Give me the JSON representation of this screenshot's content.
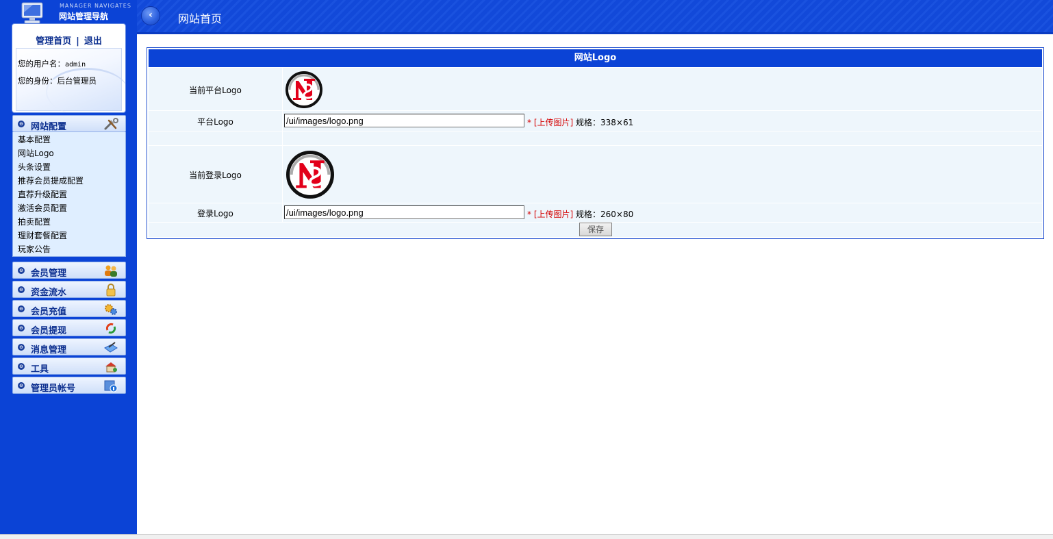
{
  "brand": {
    "subtitle": "MANAGER NAVIGATES",
    "title": "网站管理导航"
  },
  "user_panel": {
    "home_link": "管理首页",
    "separator": "|",
    "logout_link": "退出",
    "username_label": "您的用户名：",
    "username": "admin",
    "role_label": "您的身份：",
    "role": "后台管理员"
  },
  "sidebar": {
    "active_group": {
      "label": "网站配置",
      "icon": "tools-icon"
    },
    "sub_items": [
      {
        "label": "基本配置"
      },
      {
        "label": "网站Logo"
      },
      {
        "label": "头条设置"
      },
      {
        "label": "推荐会员提成配置"
      },
      {
        "label": "直荐升级配置"
      },
      {
        "label": "激活会员配置"
      },
      {
        "label": "拍卖配置"
      },
      {
        "label": "理财套餐配置"
      },
      {
        "label": "玩家公告"
      }
    ],
    "groups": [
      {
        "label": "会员管理",
        "icon": "users-icon"
      },
      {
        "label": "资金流水",
        "icon": "lock-icon"
      },
      {
        "label": "会员充值",
        "icon": "gears-icon"
      },
      {
        "label": "会员提现",
        "icon": "refresh-icon"
      },
      {
        "label": "消息管理",
        "icon": "message-icon"
      },
      {
        "label": "工具",
        "icon": "toolbox-icon"
      },
      {
        "label": "管理员帐号",
        "icon": "admin-info-icon"
      }
    ]
  },
  "header": {
    "back_icon": "back-arrow-icon",
    "back_label": "‹",
    "title": "网站首页"
  },
  "panel": {
    "title": "网站Logo",
    "rows": {
      "current_platform_logo": {
        "label": "当前平台Logo"
      },
      "platform_logo": {
        "label": "平台Logo",
        "value": "/ui/images/logo.png",
        "star": "*",
        "upload_link": "[上传图片]",
        "spec": " 规格：338×61"
      },
      "current_login_logo": {
        "label": "当前登录Logo"
      },
      "login_logo": {
        "label": "登录Logo",
        "value": "/ui/images/logo.png",
        "star": "*",
        "upload_link": "[上传图片]",
        "spec": " 规格：260×80"
      }
    },
    "save_button": "保存"
  },
  "colors": {
    "sidebar_bg": "#0b43d6",
    "header_bg": "#1249d9",
    "panel_head_bg": "#0b43d6",
    "row_bg": "#eef6fc",
    "link_red": "#d40000",
    "logo_red": "#e2001a"
  }
}
